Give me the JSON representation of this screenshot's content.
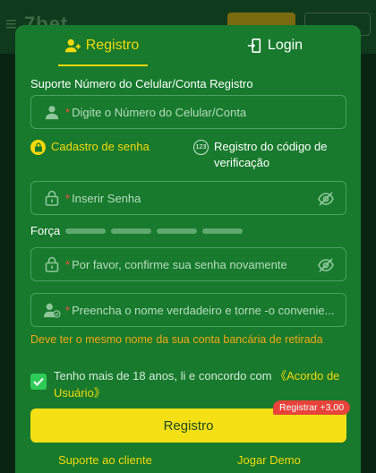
{
  "tabs": [
    {
      "label": "Registro",
      "icon": "user-plus-icon",
      "active": true
    },
    {
      "label": "Login",
      "icon": "door-enter-icon",
      "active": false
    }
  ],
  "form": {
    "section_label": "Suporte Número do Celular/Conta Registro",
    "phone_placeholder": "Digite o Número do Celular/Conta",
    "option_password": "Cadastro de senha",
    "option_code": "Registro do código de verificação",
    "option_code_badge": "123",
    "password_placeholder": "Inserir Senha",
    "strength_label": "Força",
    "confirm_placeholder": "Por favor, confirme sua senha novamente",
    "name_placeholder": "Preencha o nome verdadeiro e torne -o convenie...",
    "name_warning": "Deve ter o mesmo nome da sua conta bancária de retirada",
    "required_mark": "*"
  },
  "agreement": {
    "checked": true,
    "text": "Tenho mais de 18 anos, li e concordo com ",
    "link": "《Acordo de Usuário》"
  },
  "register_button": {
    "label": "Registro",
    "bonus": "Registrar +3,00"
  },
  "footer": {
    "support": "Suporte ao cliente",
    "demo": "Jogar Demo"
  },
  "colors": {
    "modal_bg": "#177a2d",
    "accent": "#f5d90a",
    "warning": "#f5a614",
    "bonus_bg": "#e8433a"
  }
}
